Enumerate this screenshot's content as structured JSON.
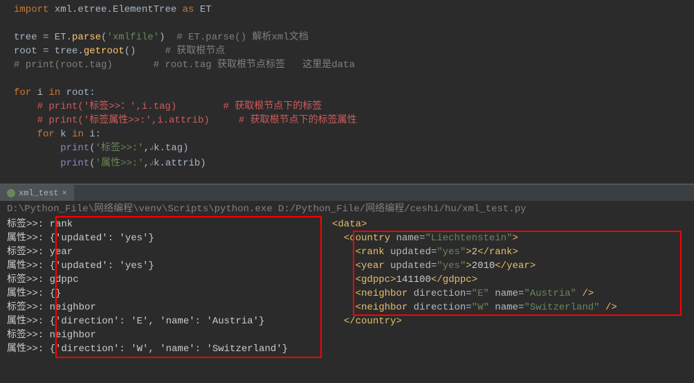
{
  "editor": {
    "l1_import": "import",
    "l1_mod": " xml.etree.ElementTree ",
    "l1_as": "as",
    "l1_et": " ET",
    "l3_a": "tree = ET.",
    "l3_fn": "parse",
    "l3_b": "(",
    "l3_str": "'xmlfile'",
    "l3_c": ")  ",
    "l3_cmt": "# ET.parse() 解析xml文档",
    "l4_a": "root = tree.",
    "l4_fn": "getroot",
    "l4_b": "()     ",
    "l4_cmt": "# 获取根节点",
    "l5_cmt": "# print(root.tag)       # root.tag 获取根节点标签   这里是data",
    "l7_for": "for",
    "l7_a": " i ",
    "l7_in": "in",
    "l7_b": " root:",
    "l8_cmt": "    # print('标签>>：',i.tag)        # 获取根节点下的标签",
    "l9_cmt": "    # print('标签属性>>:',i.attrib)     # 获取根节点下的标签属性",
    "l10_a": "    ",
    "l10_for": "for",
    "l10_b": " k ",
    "l10_in": "in",
    "l10_c": " i:",
    "l11_a": "        ",
    "l11_fn": "print",
    "l11_b": "(",
    "l11_str": "'标签>>:'",
    "l11_c": ",",
    "l11_d": "k.tag)",
    "l12_a": "        ",
    "l12_fn": "print",
    "l12_b": "(",
    "l12_str": "'属性>>:'",
    "l12_c": ",",
    "l12_d": "k.attrib)"
  },
  "tab": {
    "label": "xml_test",
    "close": "×"
  },
  "console": {
    "header": "D:\\Python_File\\网络编程\\venv\\Scripts\\python.exe D:/Python_File/网络编程/ceshi/hu/xml_test.py",
    "out1": "标签>>: rank",
    "out2": "属性>>: {'updated': 'yes'}",
    "out3": "标签>>: year",
    "out4": "属性>>: {'updated': 'yes'}",
    "out5": "标签>>: gdppc",
    "out6": "属性>>: {}",
    "out7": "标签>>: neighbor",
    "out8": "属性>>: {'direction': 'E', 'name': 'Austria'}",
    "out9": "标签>>: neighbor",
    "out10": "属性>>: {'direction': 'W', 'name': 'Switzerland'}"
  },
  "xml": {
    "l1a": "<",
    "l1b": "data",
    "l1c": ">",
    "l2a": "  <",
    "l2b": "country ",
    "l2c": "name",
    "l2d": "=",
    "l2e": "\"Liechtenstein\"",
    "l2f": ">",
    "l3a": "    <",
    "l3b": "rank ",
    "l3c": "updated",
    "l3d": "=",
    "l3e": "\"yes\"",
    "l3f": ">",
    "l3g": "2",
    "l3h": "</",
    "l3i": "rank",
    "l3j": ">",
    "l4a": "    <",
    "l4b": "year ",
    "l4c": "updated",
    "l4d": "=",
    "l4e": "\"yes\"",
    "l4f": ">",
    "l4g": "2010",
    "l4h": "</",
    "l4i": "year",
    "l4j": ">",
    "l5a": "    <",
    "l5b": "gdppc",
    "l5c": ">",
    "l5d": "141100",
    "l5e": "</",
    "l5f": "gdppc",
    "l5g": ">",
    "l6a": "    <",
    "l6b": "neighbor ",
    "l6c": "direction",
    "l6d": "=",
    "l6e": "\"E\"",
    "l6f": " ",
    "l6g": "name",
    "l6h": "=",
    "l6i": "\"Austria\"",
    "l6j": " />",
    "l7a": "    <",
    "l7b": "neighbor ",
    "l7c": "direction",
    "l7d": "=",
    "l7e": "\"W\"",
    "l7f": " ",
    "l7g": "name",
    "l7h": "=",
    "l7i": "\"Switzerland\"",
    "l7j": " />",
    "l8a": "  </",
    "l8b": "country",
    "l8c": ">"
  },
  "bunny": "↲"
}
